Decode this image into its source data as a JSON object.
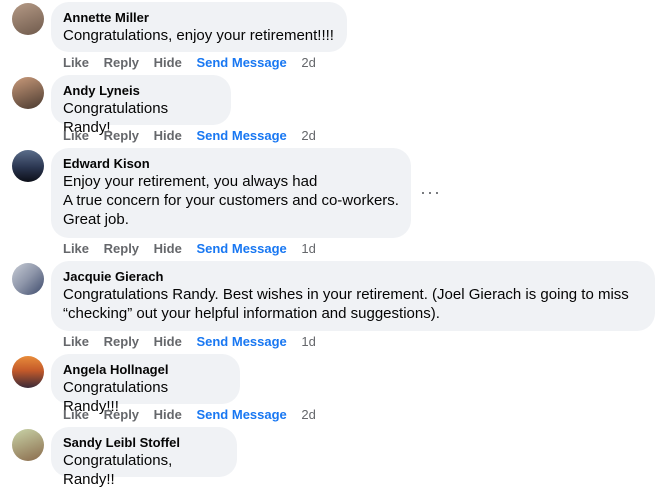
{
  "actions": {
    "like": "Like",
    "reply": "Reply",
    "hide": "Hide",
    "send_message": "Send Message"
  },
  "comments": [
    {
      "author": "Annette Miller",
      "lines": [
        "Congratulations, enjoy your retirement!!!!"
      ],
      "time": "2d",
      "avatar_colors": [
        "#b59a86",
        "#6f5a4c"
      ]
    },
    {
      "author": "Andy Lyneis",
      "lines": [
        "Congratulations Randy!"
      ],
      "time": "2d",
      "avatar_colors": [
        "#c99a7a",
        "#4a3a30"
      ]
    },
    {
      "author": "Edward Kison",
      "lines": [
        "Enjoy your retirement, you always had",
        "A true concern for your customers and co-workers.",
        "Great job."
      ],
      "time": "1d",
      "avatar_colors": [
        "#5a6d8a",
        "#0c0f18"
      ],
      "more_icon": "···"
    },
    {
      "author": "Jacquie Gierach",
      "lines": [
        "Congratulations Randy. Best wishes in your retirement. (Joel Gierach is going to miss",
        "“checking” out your helpful information and suggestions)."
      ],
      "time": "1d",
      "avatar_colors": [
        "#c8cdd6",
        "#3d4a6b"
      ]
    },
    {
      "author": "Angela Hollnagel",
      "lines": [
        "Congratulations Randy!!!"
      ],
      "time": "2d",
      "avatar_colors": [
        "#e88c3a",
        "#3a2a38"
      ]
    },
    {
      "author": "Sandy Leibl Stoffel",
      "lines": [
        "Congratulations, Randy!!"
      ],
      "time": "",
      "avatar_colors": [
        "#c9d4a8",
        "#8a6b4c"
      ]
    }
  ]
}
